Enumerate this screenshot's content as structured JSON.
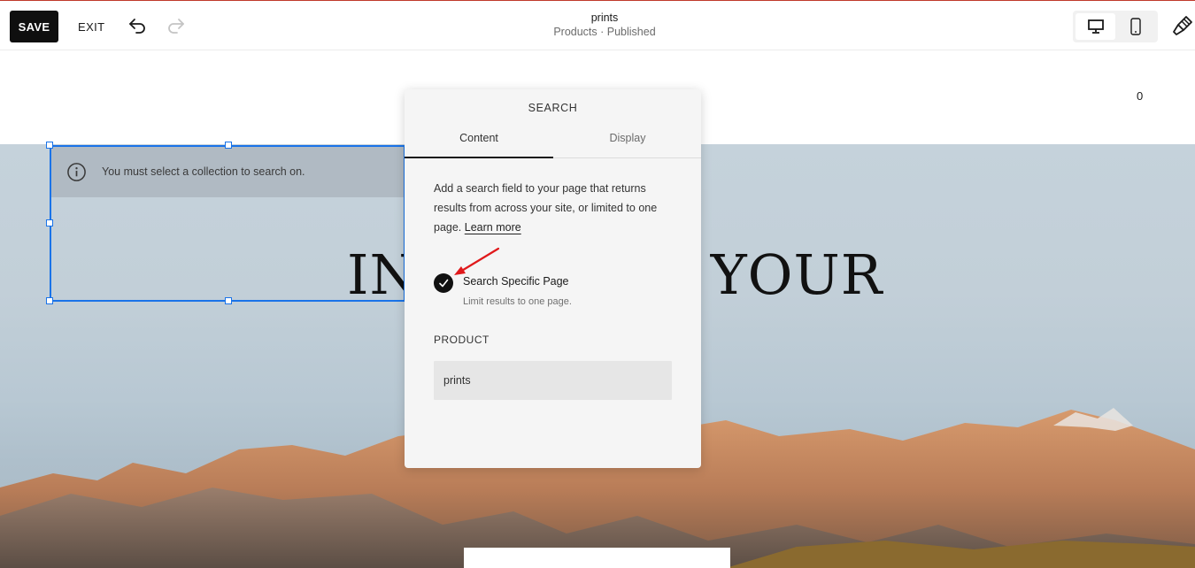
{
  "toolbar": {
    "save_label": "SAVE",
    "exit_label": "EXIT",
    "page_name": "prints",
    "page_status": "Products · Published"
  },
  "site": {
    "cart_count": "0",
    "hero_title_left": "IN",
    "hero_title_right": "YOUR"
  },
  "search_block": {
    "notice": "You must select a collection to search on."
  },
  "panel": {
    "title": "SEARCH",
    "tabs": [
      {
        "label": "Content",
        "active": true
      },
      {
        "label": "Display",
        "active": false
      }
    ],
    "description": "Add a search field to your page that returns results from across your site, or limited to one page.",
    "learn_more": "Learn more",
    "option_label": "Search Specific Page",
    "option_sub": "Limit results to one page.",
    "product_label": "PRODUCT",
    "product_value": "prints"
  },
  "colors": {
    "selection": "#1a73e8",
    "annotation_arrow": "#e0191b",
    "save_bg": "#0f0f0f"
  }
}
